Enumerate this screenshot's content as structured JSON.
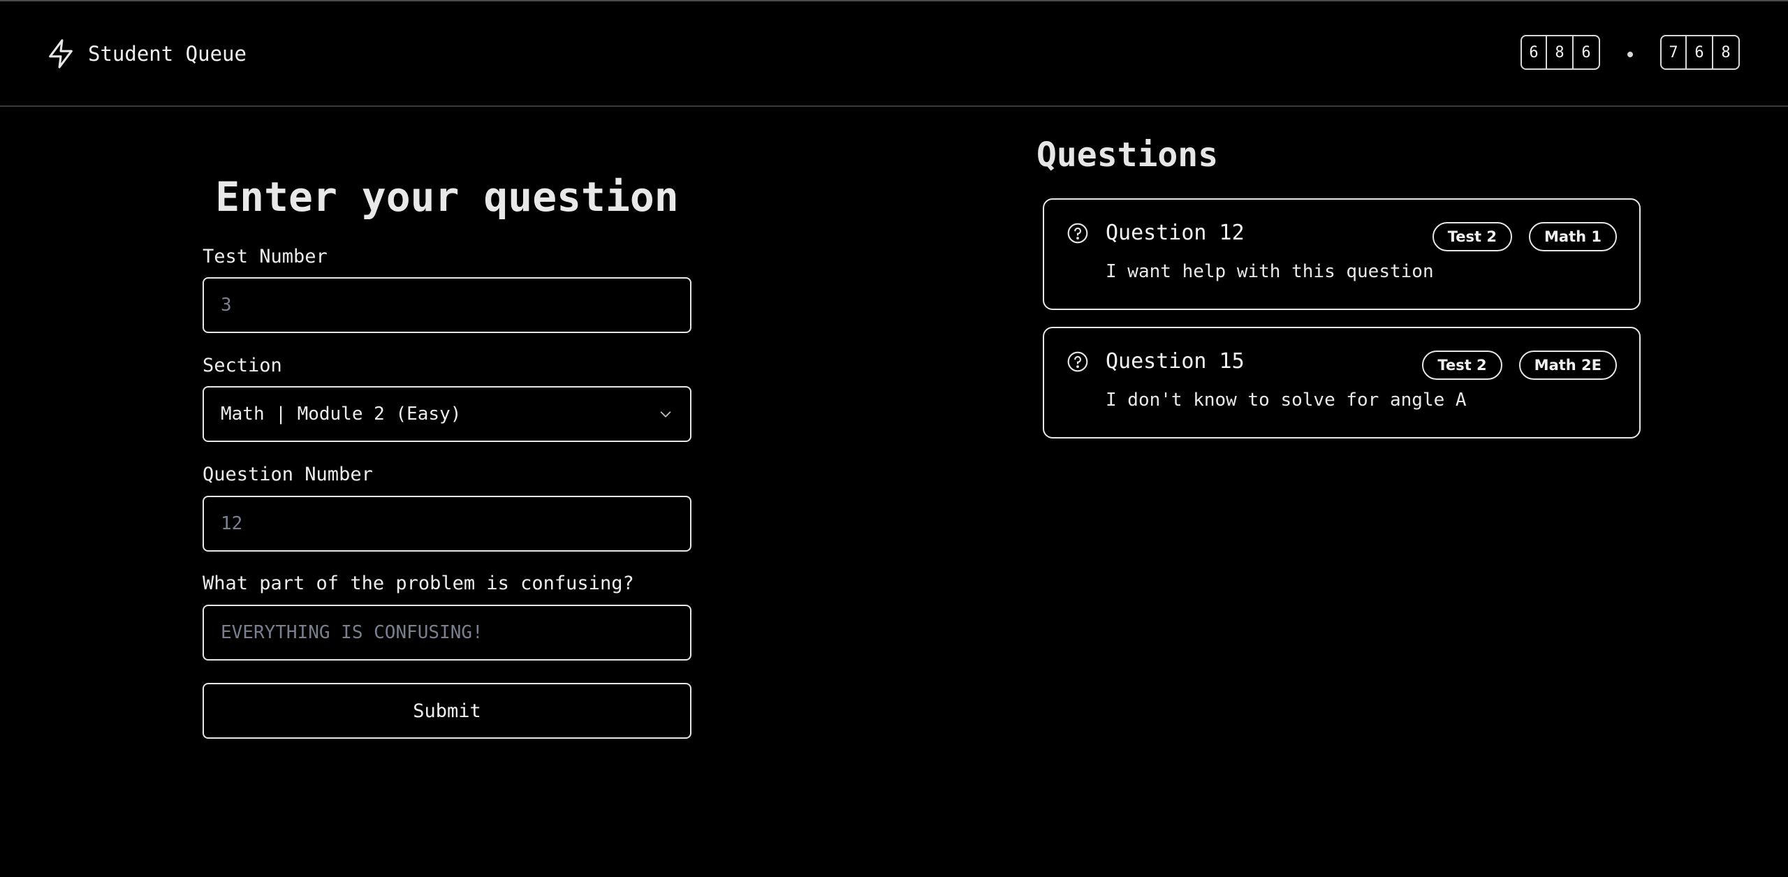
{
  "header": {
    "title": "Student Queue",
    "code_left": [
      "6",
      "8",
      "6"
    ],
    "code_right": [
      "7",
      "6",
      "8"
    ]
  },
  "form": {
    "title": "Enter your question",
    "test_number": {
      "label": "Test Number",
      "placeholder": "3"
    },
    "section": {
      "label": "Section",
      "value": "Math | Module 2 (Easy)"
    },
    "question_number": {
      "label": "Question Number",
      "placeholder": "12"
    },
    "confusing": {
      "label": "What part of the problem is confusing?",
      "placeholder": "EVERYTHING IS CONFUSING!"
    },
    "submit_label": "Submit"
  },
  "questions": {
    "heading": "Questions",
    "items": [
      {
        "title": "Question 12",
        "description": "I want help with this question",
        "badges": [
          "Test 2",
          "Math 1"
        ]
      },
      {
        "title": "Question 15",
        "description": "I don't know to solve for angle A",
        "badges": [
          "Test 2",
          "Math 2E"
        ]
      }
    ]
  }
}
